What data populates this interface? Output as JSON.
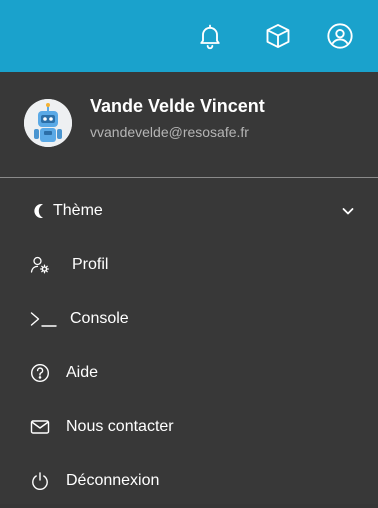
{
  "header": {
    "icons": [
      "bell-icon",
      "cube-icon",
      "user-circle-icon"
    ],
    "background": "#1aa2cc"
  },
  "user": {
    "name": "Vande Velde Vincent",
    "email": "vvandevelde@resosafe.fr",
    "avatar_icon": "robot-avatar"
  },
  "menu": {
    "items": [
      {
        "label": "Thème",
        "icon": "moon-icon",
        "has_submenu": true
      },
      {
        "label": "Profil",
        "icon": "user-gear-icon"
      },
      {
        "label": "Console",
        "icon": "terminal-icon"
      },
      {
        "label": "Aide",
        "icon": "question-circle-icon"
      },
      {
        "label": "Nous contacter",
        "icon": "envelope-icon"
      },
      {
        "label": "Déconnexion",
        "icon": "power-icon"
      }
    ]
  },
  "colors": {
    "menu_background": "#383838",
    "email_text": "#b5b5b5",
    "divider": "#8a8a8a"
  }
}
